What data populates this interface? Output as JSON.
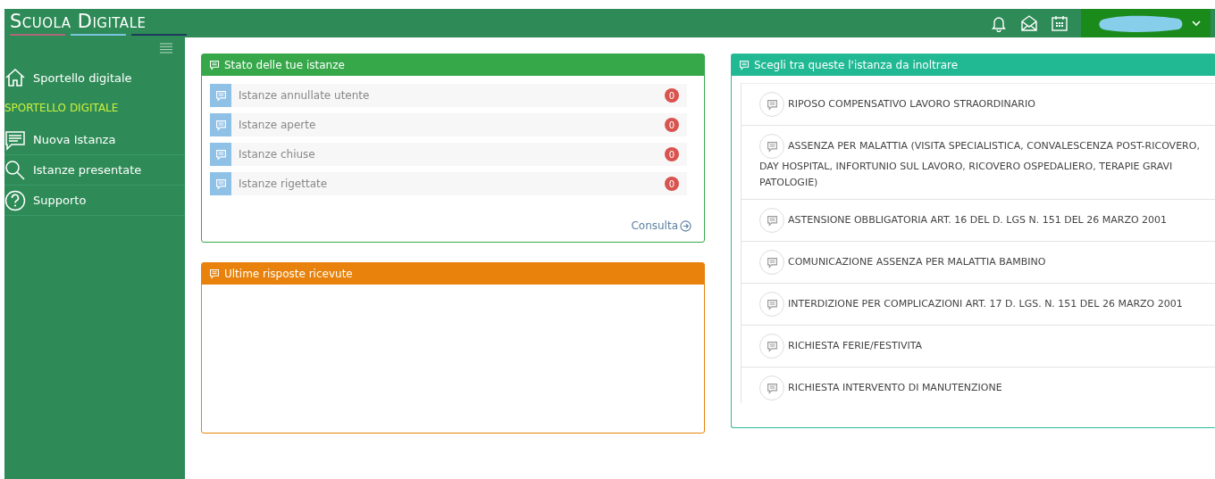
{
  "header": {
    "logo": "Scuola Digitale"
  },
  "sidebar": {
    "items": [
      {
        "kind": "link",
        "label": "Sportello digitale"
      },
      {
        "kind": "heading",
        "label": "SPORTELLO DIGITALE"
      },
      {
        "kind": "link",
        "label": "Nuova Istanza"
      },
      {
        "kind": "link",
        "label": "Istanze presentate"
      },
      {
        "kind": "link",
        "label": "Supporto"
      }
    ]
  },
  "status_panel": {
    "title": "Stato delle tue istanze",
    "rows": [
      {
        "label": "Istanze annullate utente",
        "count": "0"
      },
      {
        "label": "Istanze aperte",
        "count": "0"
      },
      {
        "label": "Istanze chiuse",
        "count": "0"
      },
      {
        "label": "Istanze rigettate",
        "count": "0"
      }
    ],
    "link": "Consulta"
  },
  "responses_panel": {
    "title": "Ultime risposte ricevute"
  },
  "choices_panel": {
    "title": "Scegli tra queste l'istanza da inoltrare",
    "items": [
      "RIPOSO COMPENSATIVO LAVORO STRAORDINARIO",
      "ASSENZA PER MALATTIA (VISITA SPECIALISTICA, CONVALESCENZA POST-RICOVERO, DAY HOSPITAL, INFORTUNIO SUL LAVORO, RICOVERO OSPEDALIERO, TERAPIE GRAVI PATOLOGIE)",
      "ASTENSIONE OBBLIGATORIA ART. 16 DEL D. LGS N. 151 DEL 26 MARZO 2001",
      "COMUNICAZIONE ASSENZA PER MALATTIA BAMBINO",
      "INTERDIZIONE PER COMPLICAZIONI ART. 17 D. LGS. N. 151 DEL 26 MARZO 2001",
      "RICHIESTA FERIE/FESTIVITA",
      "RICHIESTA INTERVENTO DI MANUTENZIONE"
    ]
  }
}
